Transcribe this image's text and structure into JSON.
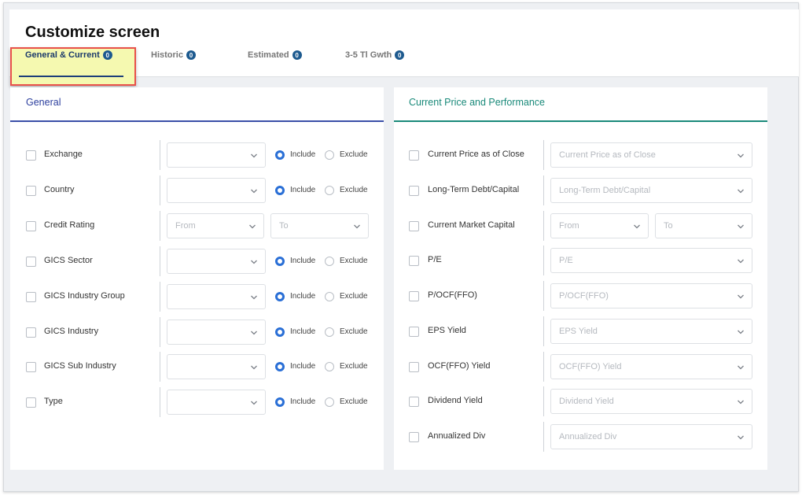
{
  "window": {
    "title": "Customize screen"
  },
  "tabs": [
    {
      "label": "General & Current",
      "count": "0",
      "active": true
    },
    {
      "label": "Historic",
      "count": "0",
      "active": false
    },
    {
      "label": "Estimated",
      "count": "0",
      "active": false
    },
    {
      "label": "3-5 Tl Gwth",
      "count": "0",
      "active": false
    }
  ],
  "general": {
    "title": "General",
    "include_label": "Include",
    "exclude_label": "Exclude",
    "from_placeholder": "From",
    "to_placeholder": "To",
    "rows": [
      {
        "label": "Exchange",
        "kind": "select-radio"
      },
      {
        "label": "Country",
        "kind": "select-radio"
      },
      {
        "label": "Credit Rating",
        "kind": "range"
      },
      {
        "label": "GICS Sector",
        "kind": "select-radio"
      },
      {
        "label": "GICS Industry Group",
        "kind": "select-radio"
      },
      {
        "label": "GICS Industry",
        "kind": "select-radio"
      },
      {
        "label": "GICS Sub Industry",
        "kind": "select-radio"
      },
      {
        "label": "Type",
        "kind": "select-radio"
      }
    ]
  },
  "current": {
    "title": "Current Price and Performance",
    "from_placeholder": "From",
    "to_placeholder": "To",
    "rows": [
      {
        "label": "Current Price as of Close",
        "placeholder": "Current Price as of Close",
        "kind": "select"
      },
      {
        "label": "Long-Term Debt/Capital",
        "placeholder": "Long-Term Debt/Capital",
        "kind": "select"
      },
      {
        "label": "Current Market Capital",
        "placeholder": "",
        "kind": "range"
      },
      {
        "label": "P/E",
        "placeholder": "P/E",
        "kind": "select"
      },
      {
        "label": "P/OCF(FFO)",
        "placeholder": "P/OCF(FFO)",
        "kind": "select"
      },
      {
        "label": "EPS Yield",
        "placeholder": "EPS Yield",
        "kind": "select"
      },
      {
        "label": "OCF(FFO) Yield",
        "placeholder": "OCF(FFO) Yield",
        "kind": "select"
      },
      {
        "label": "Dividend Yield",
        "placeholder": "Dividend Yield",
        "kind": "select"
      },
      {
        "label": "Annualized Div",
        "placeholder": "Annualized Div",
        "kind": "select"
      }
    ]
  },
  "colors": {
    "accent_blue": "#2a6fd6",
    "general_title": "#2c3f9e",
    "current_title": "#1a8a7a",
    "tab_badge": "#1d5a8f",
    "highlight": "#f5f9b0",
    "highlight_border": "#e8514a"
  }
}
